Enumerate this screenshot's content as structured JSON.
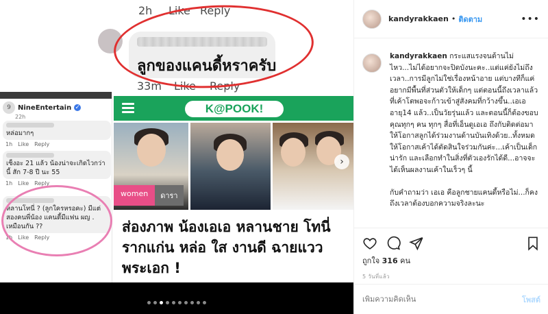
{
  "media": {
    "big_comment": {
      "time_top": "2h",
      "like_top": "Like",
      "reply_top": "Reply",
      "text": "ลูกของแคนดี้หราครับ",
      "time_bottom": "33m",
      "like_bottom": "Like",
      "reply_bottom": "Reply"
    },
    "fb": {
      "page_name": "NineEntertain",
      "page_time": "22h",
      "comments": [
        {
          "text": "หล่อมากๆ",
          "time": "1h",
          "like": "Like",
          "reply": "Reply"
        },
        {
          "text": "เซ็งอะ 21 แล้ว น้องน่าจะเกิดไวกว่านี้ สัก 7-8 ปี นะ 55",
          "time": "1h",
          "like": "Like",
          "reply": "Reply"
        },
        {
          "text": "หลานโทนี่ ? (ลูกใครหรอคะ) มีแต่สองคนพี่น้อง แคนดี้มีแฟน ผญ . เหมือนกัน ??",
          "time": "1h",
          "like": "Like",
          "reply": "Reply"
        }
      ]
    },
    "kapook": {
      "logo": "K@POOK!",
      "tag_women": "women",
      "tag_dara": "ดารา",
      "title": "ส่องภาพ น้องเอเอ หลานชาย โทนี่ รากแก่น หล่อ ใส งานดี ฉายแวว พระเอก !",
      "next_arrow": "›"
    },
    "carousel": {
      "count": 10,
      "active_index": 2
    }
  },
  "side": {
    "username": "kandyrakkaen",
    "dot": "•",
    "follow_label": "ติดตาม",
    "more": "•••",
    "caption_user": "kandyrakkaen",
    "caption_p1": "กระแสแรงจนต้านไม่ไหว...ไม่ได้อยากจะปิดบังนะคะ..แต่แค่ยังไม่ถึงเวลา..การมีลูกไม่ใช่เรื่องหน้าอาย แต่บางทีก็แค่อยากมีพื้นที่ส่วนตัวให้เด็กๆ แต่ตอนนี้ถึงเวลาแล้ว ที่เค้าโตพอจะก้าวเข้าสู่สังคมที่กว้างขึ้น..เอเออายุ14 แล้ว..เป็นวัยรุ่นแล้ว และตอนนี้ก็ต้องขอบคุณทุกๆ คน ทุกๆ สื่อที่เอ็นดูเอเอ ถึงกับติดต่อมาให้โอกาสลูกได้ร่วมงานด้านบันเทิงด้วย..ทั้งหมด ให้โอกาสเค้าได้ตัดสินใจร่วมกันค่ะ...เค้าเป็นเด็กน่ารัก และเลือกทำในสิ่งที่ตัวเองรักได้ดี...อาจจะได้เห็นผลงานเค้าในเร็วๆ นี้",
    "caption_p2": "กับคำถามว่า เอเอ คือลูกชายแคนดี้หรือไม่...ก็คงถึงเวลาต้องบอกความจริงละนะ",
    "likes_prefix": "ถูกใจ",
    "likes_count": "316",
    "likes_suffix": "คน",
    "ago": "5 วันที่แล้ว",
    "comment_placeholder": "เพิ่มความคิดเห็น",
    "post_label": "โพสต์"
  },
  "colors": {
    "follow": "#3897f0",
    "kapook_green": "#1aa35b",
    "women_pink": "#e84e87",
    "red_circle": "#e03030",
    "pink_circle": "#e97fb3"
  }
}
